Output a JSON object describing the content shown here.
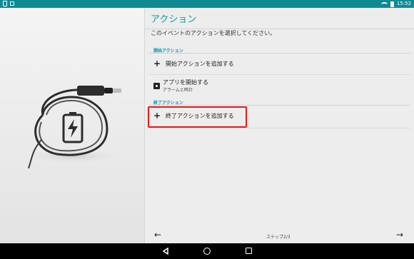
{
  "status_bar": {
    "time": "15:52"
  },
  "header": {
    "title": "アクション",
    "subtitle": "このイベントのアクションを選択してください。"
  },
  "sections": {
    "start": {
      "header": "開始アクション",
      "add_label": "開始アクションを追加する",
      "app_label": "アプリを開始する",
      "app_sub": "アラームと時計"
    },
    "end": {
      "header": "終了アクション",
      "add_label": "終了アクションを追加する"
    }
  },
  "footer": {
    "step": "ステップ2/3",
    "back_icon": "arrow-left-icon",
    "next_icon": "arrow-right-icon"
  },
  "colors": {
    "accent": "#0b9aa8",
    "status_bar": "#0f8a95",
    "highlight": "#e21b1b"
  }
}
